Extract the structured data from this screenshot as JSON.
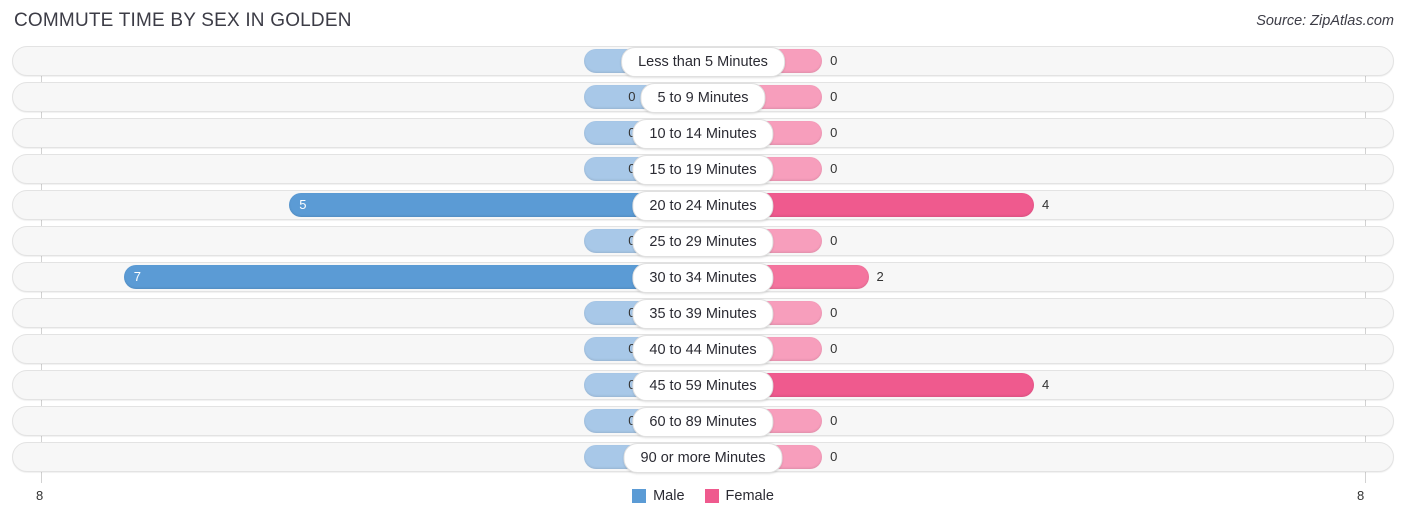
{
  "header": {
    "title": "COMMUTE TIME BY SEX IN GOLDEN",
    "source": "Source: ZipAtlas.com"
  },
  "footer": {
    "axis_left": "8",
    "axis_right": "8",
    "legend": [
      {
        "label": "Male",
        "color": "#5b9bd5",
        "icon": "male-swatch"
      },
      {
        "label": "Female",
        "color": "#ef5a8e",
        "icon": "female-swatch"
      }
    ]
  },
  "chart_data": {
    "type": "bar",
    "title": "COMMUTE TIME BY SEX IN GOLDEN",
    "subtitle": "Source: ZipAtlas.com",
    "orientation": "horizontal-diverging",
    "xlabel": "",
    "ylabel": "",
    "xlim": [
      8,
      8
    ],
    "axis_max_left": 8,
    "axis_max_right": 8,
    "grid": false,
    "legend_position": "bottom-center",
    "categories": [
      "Less than 5 Minutes",
      "5 to 9 Minutes",
      "10 to 14 Minutes",
      "15 to 19 Minutes",
      "20 to 24 Minutes",
      "25 to 29 Minutes",
      "30 to 34 Minutes",
      "35 to 39 Minutes",
      "40 to 44 Minutes",
      "45 to 59 Minutes",
      "60 to 89 Minutes",
      "90 or more Minutes"
    ],
    "series": [
      {
        "name": "Male",
        "color": "#5b9bd5",
        "values": [
          0,
          0,
          0,
          0,
          5,
          0,
          7,
          0,
          0,
          0,
          0,
          0
        ]
      },
      {
        "name": "Female",
        "color": "#ef5a8e",
        "values": [
          0,
          0,
          0,
          0,
          4,
          0,
          2,
          0,
          0,
          4,
          0,
          0
        ]
      }
    ]
  },
  "rows": [
    {
      "label": "Less than 5 Minutes",
      "male": "0",
      "female": "0"
    },
    {
      "label": "5 to 9 Minutes",
      "male": "0",
      "female": "0"
    },
    {
      "label": "10 to 14 Minutes",
      "male": "0",
      "female": "0"
    },
    {
      "label": "15 to 19 Minutes",
      "male": "0",
      "female": "0"
    },
    {
      "label": "20 to 24 Minutes",
      "male": "5",
      "female": "4"
    },
    {
      "label": "25 to 29 Minutes",
      "male": "0",
      "female": "0"
    },
    {
      "label": "30 to 34 Minutes",
      "male": "7",
      "female": "2"
    },
    {
      "label": "35 to 39 Minutes",
      "male": "0",
      "female": "0"
    },
    {
      "label": "40 to 44 Minutes",
      "male": "0",
      "female": "0"
    },
    {
      "label": "45 to 59 Minutes",
      "male": "0",
      "female": "4"
    },
    {
      "label": "60 to 89 Minutes",
      "male": "0",
      "female": "0"
    },
    {
      "label": "90 or more Minutes",
      "male": "0",
      "female": "0"
    }
  ]
}
